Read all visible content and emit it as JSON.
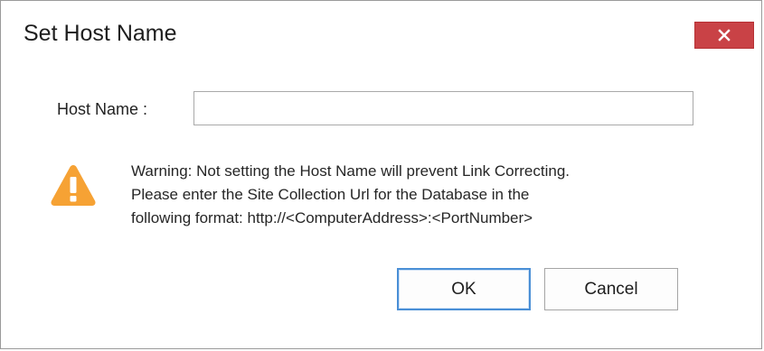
{
  "dialog": {
    "title": "Set Host Name",
    "close_label": "✕"
  },
  "form": {
    "host_label": "Host Name :",
    "host_value": "",
    "host_placeholder": ""
  },
  "warning": {
    "icon": "warning-triangle-icon",
    "line1": "Warning: Not setting the Host Name will prevent Link Correcting.",
    "line2": "Please enter the Site Collection Url for the Database in the",
    "line3": "following format: http://<ComputerAddress>:<PortNumber>"
  },
  "buttons": {
    "ok_label": "OK",
    "cancel_label": "Cancel"
  },
  "colors": {
    "close_button": "#c94246",
    "warning_icon": "#f6a234",
    "ok_focus_border": "#4a8fd6"
  }
}
